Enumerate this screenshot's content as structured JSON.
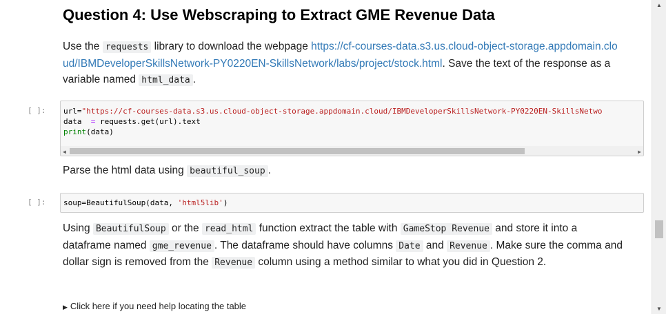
{
  "heading": "Question 4: Use Webscraping to Extract GME Revenue Data",
  "p1": {
    "t1": "Use the ",
    "c1": "requests",
    "t2": " library to download the webpage ",
    "link": "https://cf-courses-data.s3.us.cloud-object-storage.appdomain.cloud/IBMDeveloperSkillsNetwork-PY0220EN-SkillsNetwork/labs/project/stock.html",
    "t3": ". Save the text of the response as a variable named ",
    "c2": "html_data",
    "t4": "."
  },
  "cell1": {
    "prompt": "[ ]:",
    "line1_a": "url=",
    "line1_str": "\"https://cf-courses-data.s3.us.cloud-object-storage.appdomain.cloud/IBMDeveloperSkillsNetwork-PY0220EN-SkillsNetwo",
    "line2_a": "data  ",
    "line2_op": "=",
    "line2_b": " requests.get(url).text",
    "line3_kw": "print",
    "line3_b": "(data)"
  },
  "p2": {
    "t1": "Parse the html data using ",
    "c1": "beautiful_soup",
    "t2": "."
  },
  "cell2": {
    "prompt": "[ ]:",
    "a": "soup=BeautifulSoup(data, ",
    "str": "'html5lib'",
    "b": ")"
  },
  "p3": {
    "t1": "Using ",
    "c1": "BeautifulSoup",
    "t2": " or the ",
    "c2": "read_html",
    "t3": " function extract the table with ",
    "c3": "GameStop Revenue",
    "t4": " and store it into a dataframe named ",
    "c4": "gme_revenue",
    "t5": ". The dataframe should have columns ",
    "c5": "Date",
    "t6": " and ",
    "c6": "Revenue",
    "t7": ". Make sure the comma and dollar sign is removed from the ",
    "c7": "Revenue",
    "t8": " column using a method similar to what you did in Question 2."
  },
  "details": {
    "marker": "▶",
    "summary": "Click here if you need help locating the table"
  },
  "icons": {
    "scroll_left": "◀",
    "scroll_right": "▶",
    "scroll_up": "▲",
    "scroll_down": "▼"
  }
}
